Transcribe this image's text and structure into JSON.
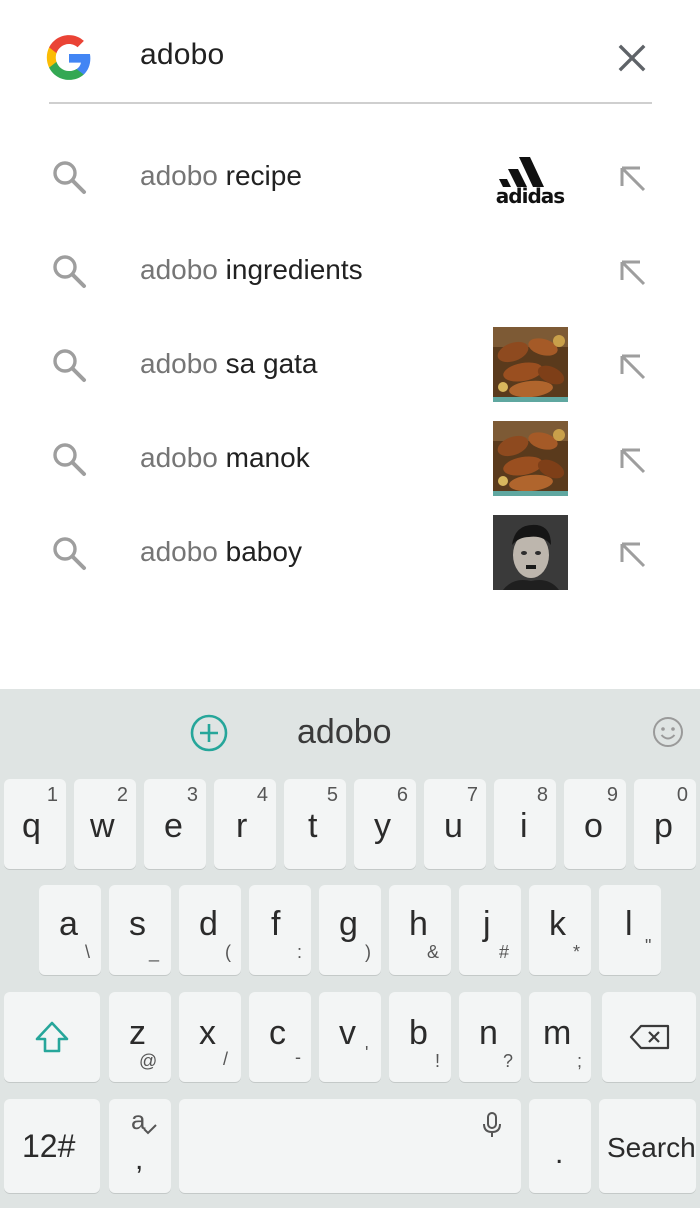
{
  "search": {
    "query": "adobo",
    "logo_icon": "google-g-icon",
    "clear_icon": "close-icon"
  },
  "suggestions": [
    {
      "prefix": "adobo",
      "rest": " recipe",
      "thumbnail": "adidas-logo",
      "thumbnail_text": "adidas"
    },
    {
      "prefix": "adobo",
      "rest": " ingredients",
      "thumbnail": ""
    },
    {
      "prefix": "adobo",
      "rest": " sa gata",
      "thumbnail": "adobo-dish-photo"
    },
    {
      "prefix": "adobo",
      "rest": " manok",
      "thumbnail": "adobo-dish-photo"
    },
    {
      "prefix": "adobo",
      "rest": " baboy",
      "thumbnail": "portrait-photo"
    }
  ],
  "keyboard": {
    "suggestion_word": "adobo",
    "row1": [
      {
        "key": "q",
        "hint": "1"
      },
      {
        "key": "w",
        "hint": "2"
      },
      {
        "key": "e",
        "hint": "3"
      },
      {
        "key": "r",
        "hint": "4"
      },
      {
        "key": "t",
        "hint": "5"
      },
      {
        "key": "y",
        "hint": "6"
      },
      {
        "key": "u",
        "hint": "7"
      },
      {
        "key": "i",
        "hint": "8"
      },
      {
        "key": "o",
        "hint": "9"
      },
      {
        "key": "p",
        "hint": "0"
      }
    ],
    "row2": [
      {
        "key": "a",
        "sub": "\\"
      },
      {
        "key": "s",
        "sub": "_"
      },
      {
        "key": "d",
        "sub": "("
      },
      {
        "key": "f",
        "sub": ":"
      },
      {
        "key": "g",
        "sub": ")"
      },
      {
        "key": "h",
        "sub": "&"
      },
      {
        "key": "j",
        "sub": "#"
      },
      {
        "key": "k",
        "sub": "*"
      },
      {
        "key": "l",
        "sub": "\""
      }
    ],
    "row3": [
      {
        "key": "z",
        "sub": "@"
      },
      {
        "key": "x",
        "sub": "/"
      },
      {
        "key": "c",
        "sub": "-"
      },
      {
        "key": "v",
        "sub": "'"
      },
      {
        "key": "b",
        "sub": "!"
      },
      {
        "key": "n",
        "sub": "?"
      },
      {
        "key": "m",
        "sub": ";"
      }
    ],
    "symbols_label": "12#",
    "lang_label": "a",
    "comma_label": ",",
    "period_label": ".",
    "search_label": "Search",
    "accent_color": "#26a69a"
  }
}
